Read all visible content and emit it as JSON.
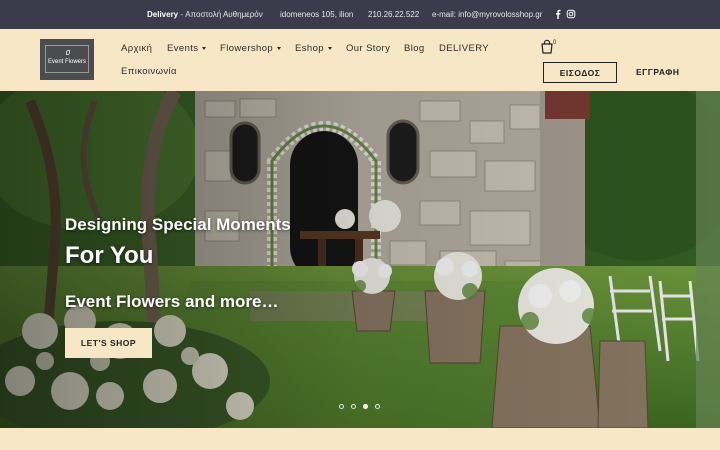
{
  "topbar": {
    "delivery_bold": "Delivery",
    "delivery_text": " - Αποστολή Αυθημερόν",
    "address": "idomeneos 105, ilion",
    "phone": "210.26.22.522",
    "email": "e-mail: info@myrovolosshop.gr",
    "icons": [
      "facebook-icon",
      "instagram-icon"
    ]
  },
  "header": {
    "logo_text": "Event Flowers",
    "nav": [
      {
        "label": "Αρχική",
        "dropdown": false
      },
      {
        "label": "Events",
        "dropdown": true
      },
      {
        "label": "Flowershop",
        "dropdown": true
      },
      {
        "label": "Eshop",
        "dropdown": true
      },
      {
        "label": "Our Story",
        "dropdown": false
      },
      {
        "label": "Blog",
        "dropdown": false
      },
      {
        "label": "DELIVERY",
        "dropdown": false
      },
      {
        "label": "Επικοινωνία",
        "dropdown": false
      }
    ],
    "cart_count": "0",
    "login_label": "ΕΙΣΟΔΟΣ",
    "register_label": "ΕΓΓΡΑΦΗ"
  },
  "hero": {
    "subtitle": "Designing Special Moments",
    "title": "For You",
    "tagline": "Event Flowers and more…",
    "button_label": "LET'S SHOP",
    "slide_count": 4,
    "active_slide": 3
  },
  "colors": {
    "topbar_bg": "#3a3c4b",
    "header_bg": "#f8e7c6",
    "accent": "#f8e7c6",
    "text": "#222222"
  }
}
